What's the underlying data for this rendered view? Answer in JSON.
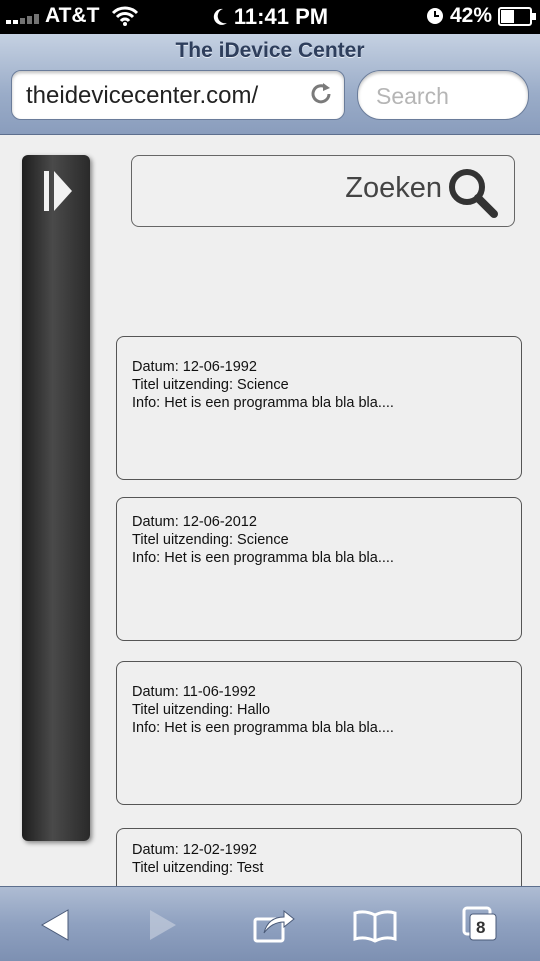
{
  "status_bar": {
    "carrier": "AT&T",
    "time": "11:41 PM",
    "battery": "42%",
    "battery_level": 0.42,
    "icons": [
      "signal-bars-icon",
      "wifi-icon",
      "moon-icon",
      "clock-icon",
      "battery-icon"
    ]
  },
  "browser": {
    "title": "The iDevice Center",
    "url": "theidevicecenter.com/",
    "search_placeholder": "Search",
    "toolbar_icons": [
      "back-arrow-icon",
      "forward-arrow-icon",
      "share-icon",
      "bookmarks-icon",
      "tabs-icon"
    ],
    "tab_count": "8",
    "accent": "#8fa1c0"
  },
  "page": {
    "search_label": "Zoeken",
    "items": [
      {
        "date": "Datum: 12-06-1992",
        "title": "Titel uitzending: Science",
        "info": "Info: Het is een programma bla bla bla...."
      },
      {
        "date": "Datum: 12-06-2012",
        "title": "Titel uitzending: Science",
        "info": "Info: Het is een programma bla bla bla...."
      },
      {
        "date": "Datum: 11-06-1992",
        "title": "Titel uitzending: Hallo",
        "info": "Info: Het is een programma bla bla bla...."
      },
      {
        "date": "Datum: 12-02-1992",
        "title": "Titel uitzending: Test"
      }
    ]
  }
}
